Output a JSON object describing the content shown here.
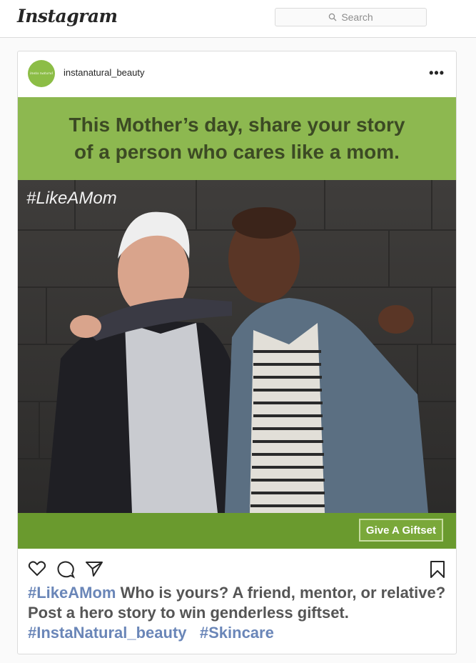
{
  "header": {
    "logo_text": "Instagram",
    "search_placeholder": "Search"
  },
  "post": {
    "username": "instanatural_beauty",
    "avatar_text": "insta natural",
    "more_label": "•••",
    "banner_line1": "This Mother’s day, share your story",
    "banner_line2": "of a person who cares like a mom.",
    "image_hashtag": "#LikeAMom",
    "cta_label": "Give A Giftset",
    "caption": {
      "hashtag1": "#LikeAMom",
      "text1": " Who is yours? A friend, mentor, or relative? Post a hero story to win genderless giftset.",
      "hashtag2": "#InstaNatural_beauty",
      "hashtag3": "#Skincare"
    }
  },
  "icons": [
    "search-icon",
    "heart-icon",
    "comment-icon",
    "share-icon",
    "bookmark-icon"
  ],
  "colors": {
    "banner_green": "#8db850",
    "cta_bar_green": "#6a9a2e",
    "hashtag_blue": "#6a86b8"
  }
}
